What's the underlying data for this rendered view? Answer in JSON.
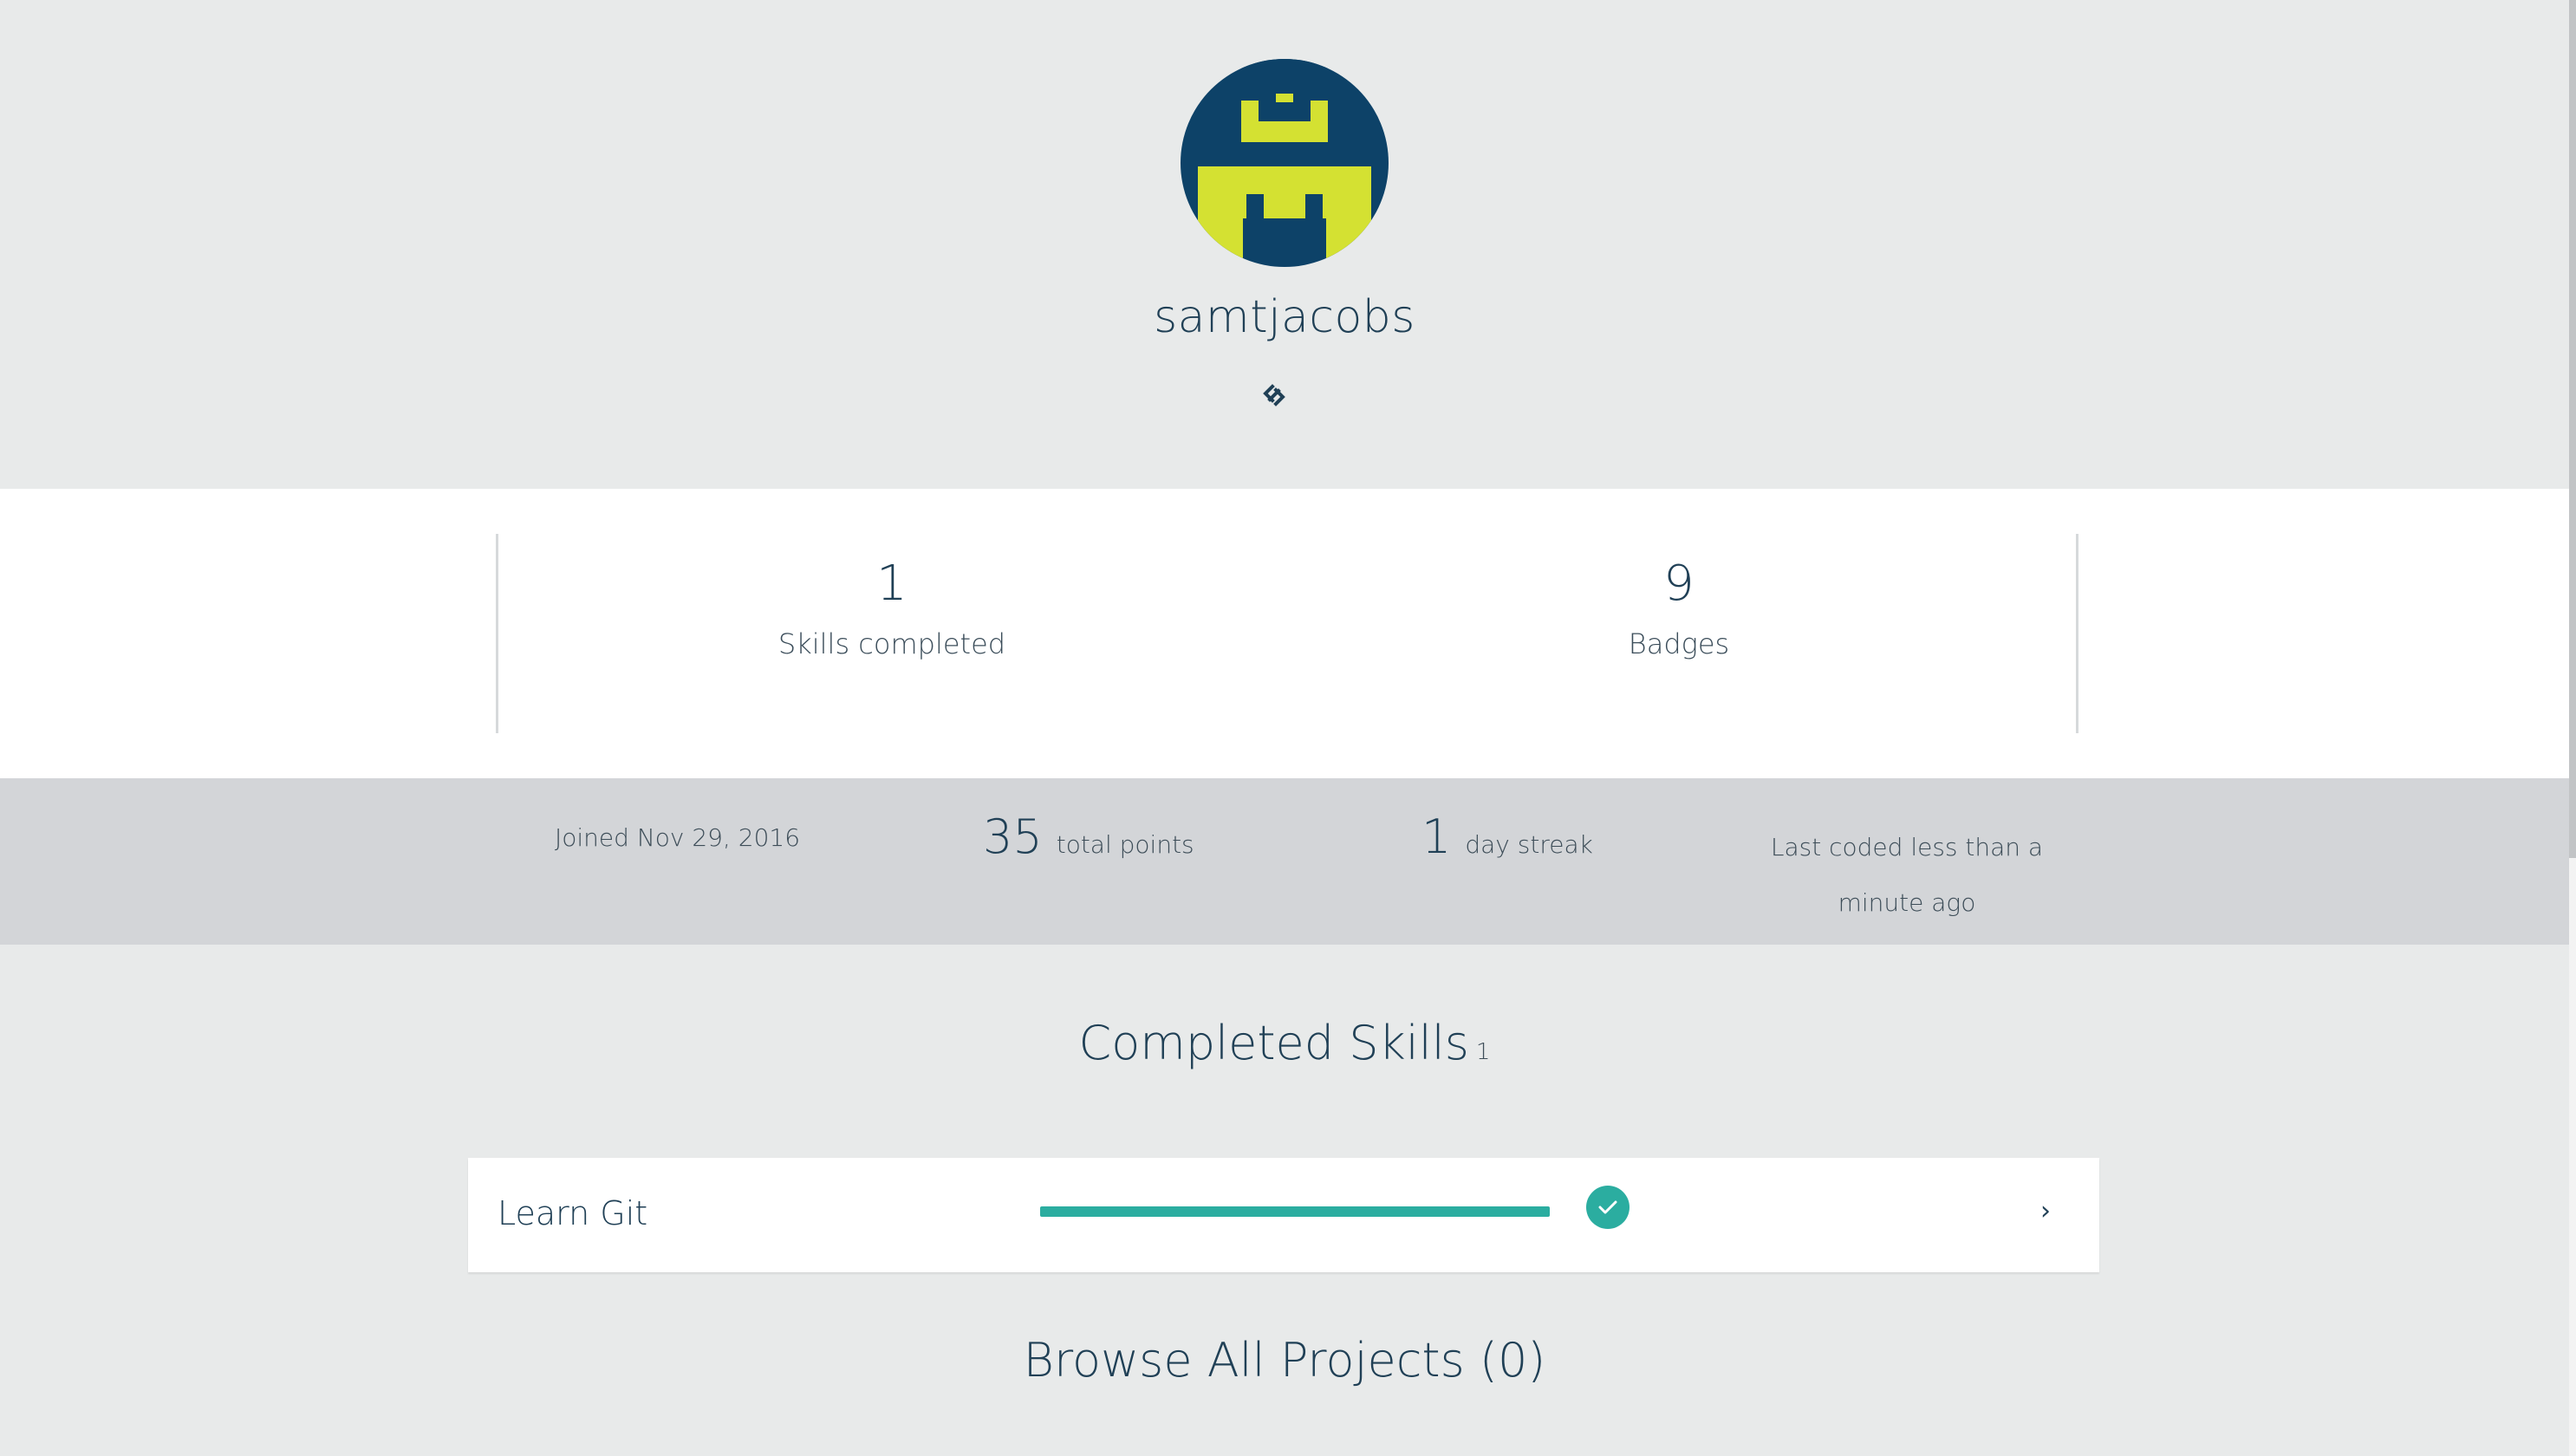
{
  "profile": {
    "username": "samtjacobs",
    "avatar_icon": "pixel-castle-avatar",
    "avatar_colors": {
      "background": "#0d4268",
      "foreground": "#d4e132"
    },
    "link_icon": "link-icon"
  },
  "stats": {
    "skills_completed": {
      "value": "1",
      "label": "Skills completed"
    },
    "badges": {
      "value": "9",
      "label": "Badges"
    }
  },
  "meta": {
    "joined": "Joined Nov 29, 2016",
    "points_value": "35",
    "points_label": "total points",
    "streak_value": "1",
    "streak_label": "day streak",
    "last_coded": "Last coded less than a minute ago"
  },
  "completed_skills": {
    "title": "Completed Skills",
    "count": "1",
    "items": [
      {
        "name": "Learn Git",
        "progress": 1.0,
        "status_icon": "check-icon",
        "chevron": "›"
      }
    ]
  },
  "browse": {
    "title": "Browse All Projects (0)"
  },
  "colors": {
    "accent": "#2bada0",
    "text": "#204056",
    "page_bg": "#e8eaea",
    "meta_bg": "#d3d5d8"
  }
}
